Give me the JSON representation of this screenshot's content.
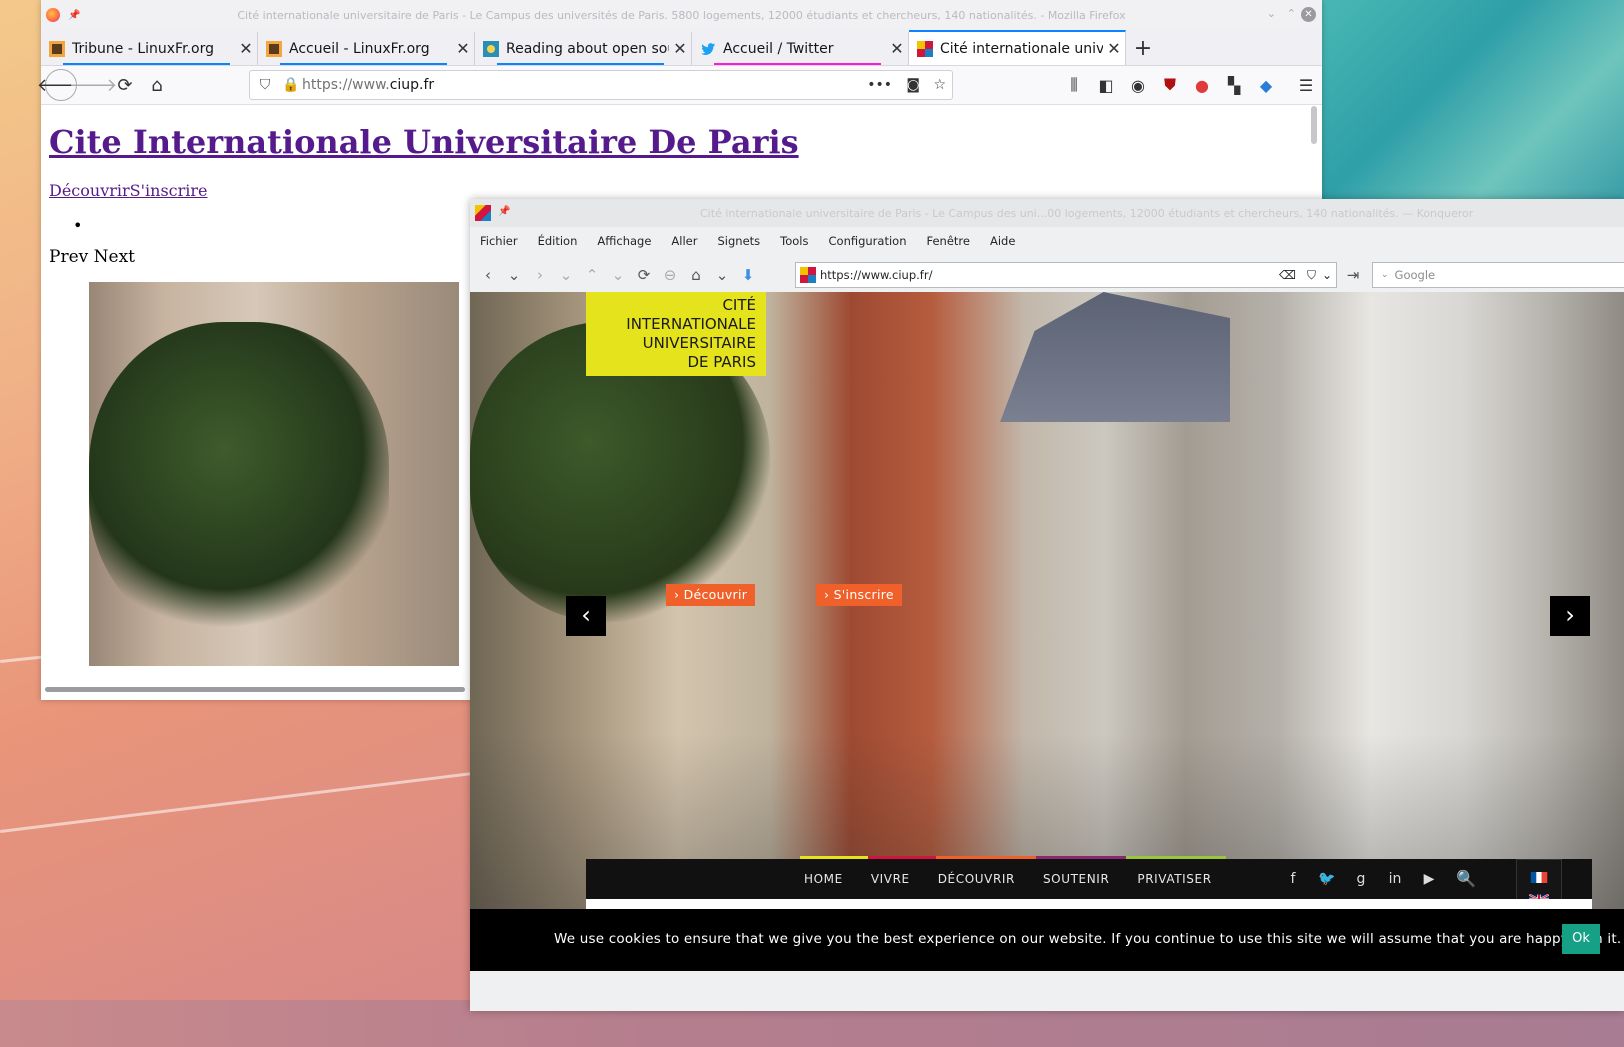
{
  "firefox": {
    "window_title": "Cité internationale universitaire de Paris - Le Campus des universités de Paris. 5800 logements, 12000 étudiants et chercheurs, 140 nationalités. - Mozilla Firefox",
    "tabs": [
      {
        "label": "Tribune - LinuxFr.org",
        "underline": "#0a84ff"
      },
      {
        "label": "Accueil - LinuxFr.org",
        "underline": "#0a84ff"
      },
      {
        "label": "Reading about open source",
        "underline": "#0a84ff"
      },
      {
        "label": "Accueil / Twitter",
        "underline": "#ff1ad9"
      },
      {
        "label": "Cité internationale universitaire de Paris",
        "underline": ""
      }
    ],
    "url_prefix": "https://www.",
    "url_domain": "ciup.fr",
    "page": {
      "heading": "Cite Internationale Universitaire De Paris",
      "link_decouvrir": "Découvrir",
      "link_inscrire": "S'inscrire",
      "bullet": "•",
      "prev_next": "Prev Next"
    }
  },
  "konqueror": {
    "window_title": "Cité internationale universitaire de Paris - Le Campus des uni...00 logements, 12000 étudiants et chercheurs, 140 nationalités. — Konqueror",
    "menu": [
      "Fichier",
      "Édition",
      "Affichage",
      "Aller",
      "Signets",
      "Tools",
      "Configuration",
      "Fenêtre",
      "Aide"
    ],
    "url": "https://www.ciup.fr/",
    "search_placeholder": "Google",
    "page": {
      "logo_lines": [
        "CITÉ",
        "INTERNATIONALE",
        "UNIVERSITAIRE",
        "DE PARIS"
      ],
      "btn_decouvrir": "› Découvrir",
      "btn_inscrire": "› S'inscrire",
      "prev_arrow": "‹",
      "next_arrow": "›",
      "nav": [
        "HOME",
        "VIVRE",
        "DÉCOUVRIR",
        "SOUTENIR",
        "PRIVATISER"
      ],
      "cookie_message": "We use cookies to ensure that we give you the best experience on our website. If you continue to use this site we will assume that you are happy with it.",
      "cookie_ok": "Ok"
    },
    "colors": {
      "accent_orange": "#f0602a",
      "logo_yellow": "#e5e41c",
      "ok_green": "#16a085"
    }
  }
}
